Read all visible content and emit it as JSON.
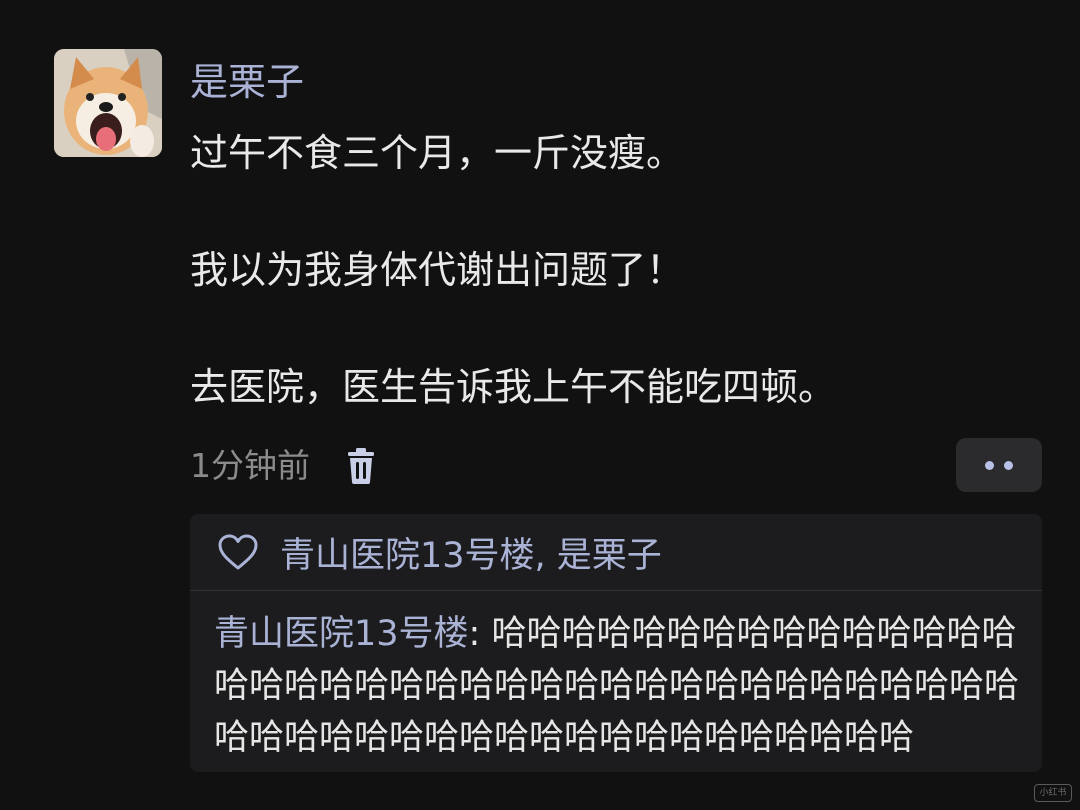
{
  "post": {
    "username": "是栗子",
    "avatar_icon": "shiba-dog-avatar",
    "lines": [
      "过午不食三个月，一斤没瘦。",
      "我以为我身体代谢出问题了！",
      "去医院，医生告诉我上午不能吃四顿。"
    ],
    "timestamp": "1分钟前",
    "delete_icon": "trash-icon",
    "more_icon": "more-dots-icon"
  },
  "reply": {
    "like_icon": "heart-outline-icon",
    "likers": "青山医院13号楼, 是栗子",
    "comment": {
      "author": "青山医院13号楼",
      "separator": ": ",
      "text": "哈哈哈哈哈哈哈哈哈哈哈哈哈哈哈哈哈哈哈哈哈哈哈哈哈哈哈哈哈哈哈哈哈哈哈哈哈哈哈哈哈哈哈哈哈哈哈哈哈哈哈哈哈哈哈哈哈哈"
    }
  },
  "watermark": "小红书",
  "colors": {
    "background": "#111111",
    "username": "#aab3d6",
    "body_text": "#e9e9e9",
    "muted_text": "#8b8b8b",
    "card_background": "#1c1c1e",
    "button_background": "#2b2b2e"
  }
}
